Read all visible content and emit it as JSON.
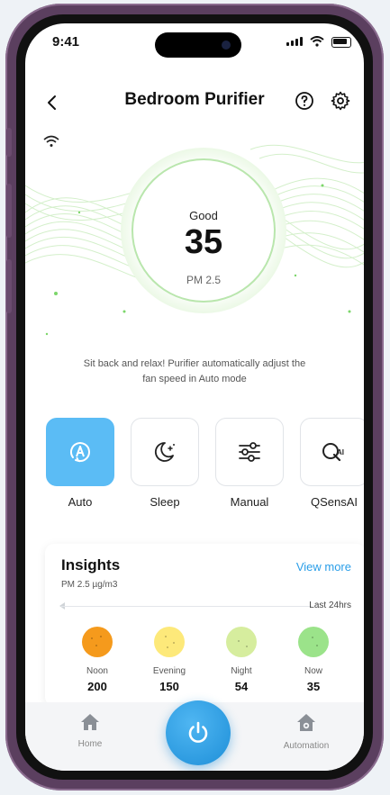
{
  "status_bar": {
    "time": "9:41"
  },
  "header": {
    "title": "Bedroom Purifier",
    "back_icon": "chevron-left-icon",
    "help_icon": "help-circle-icon",
    "settings_icon": "gear-icon"
  },
  "air_quality": {
    "status": "Good",
    "value": "35",
    "unit": "PM 2.5",
    "message": "Sit back and relax! Purifier automatically adjust the fan speed in Auto mode",
    "accent_color": "#b9e6ad"
  },
  "modes": [
    {
      "label": "Auto",
      "icon": "auto-mode-icon",
      "active": true
    },
    {
      "label": "Sleep",
      "icon": "sleep-moon-icon",
      "active": false
    },
    {
      "label": "Manual",
      "icon": "sliders-icon",
      "active": false
    },
    {
      "label": "QSensAI",
      "icon": "qsensai-icon",
      "active": false
    }
  ],
  "insights": {
    "title": "Insights",
    "subtitle": "PM 2.5 µg/m3",
    "view_more": "View more",
    "range": "Last 24hrs",
    "readings": [
      {
        "label": "Noon",
        "value": "200",
        "color": "#f59a1c"
      },
      {
        "label": "Evening",
        "value": "150",
        "color": "#fde97a"
      },
      {
        "label": "Night",
        "value": "54",
        "color": "#d6ed9e"
      },
      {
        "label": "Now",
        "value": "35",
        "color": "#9be38a"
      }
    ]
  },
  "tab_bar": {
    "home": "Home",
    "automation": "Automation"
  },
  "colors": {
    "primary": "#2a9ee8",
    "active_mode": "#5bbcf5"
  }
}
